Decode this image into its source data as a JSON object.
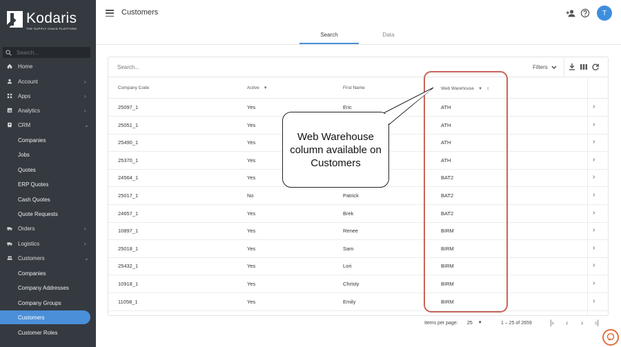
{
  "app": {
    "brand": "Kodaris",
    "tagline": "THE SUPPLY CHAIN PLATFORM"
  },
  "sidebar": {
    "search_placeholder": "Search...",
    "items": [
      {
        "label": "Home",
        "icon": "home-icon",
        "chevron": ""
      },
      {
        "label": "Account",
        "icon": "account-icon",
        "chevron": "›"
      },
      {
        "label": "Apps",
        "icon": "apps-icon",
        "chevron": "›"
      },
      {
        "label": "Analytics",
        "icon": "analytics-icon",
        "chevron": "›"
      },
      {
        "label": "CRM",
        "icon": "crm-icon",
        "chevron": "⌄"
      },
      {
        "label": "Companies",
        "icon": "",
        "chevron": ""
      },
      {
        "label": "Jobs",
        "icon": "",
        "chevron": ""
      },
      {
        "label": "Quotes",
        "icon": "",
        "chevron": ""
      },
      {
        "label": "ERP Quotes",
        "icon": "",
        "chevron": ""
      },
      {
        "label": "Cash Quotes",
        "icon": "",
        "chevron": ""
      },
      {
        "label": "Quote Requests",
        "icon": "",
        "chevron": ""
      },
      {
        "label": "Orders",
        "icon": "orders-icon",
        "chevron": "›"
      },
      {
        "label": "Logistics",
        "icon": "logistics-icon",
        "chevron": "›"
      },
      {
        "label": "Customers",
        "icon": "customers-icon",
        "chevron": "⌄"
      },
      {
        "label": "Companies",
        "icon": "",
        "chevron": ""
      },
      {
        "label": "Company Addresses",
        "icon": "",
        "chevron": ""
      },
      {
        "label": "Company Groups",
        "icon": "",
        "chevron": ""
      },
      {
        "label": "Customers",
        "icon": "",
        "chevron": ""
      },
      {
        "label": "Customer Roles",
        "icon": "",
        "chevron": ""
      }
    ]
  },
  "header": {
    "title": "Customers",
    "avatar_initial": "T"
  },
  "tabs": [
    {
      "label": "Search"
    },
    {
      "label": "Data"
    }
  ],
  "table": {
    "search_placeholder": "Search...",
    "filters_label": "Filters",
    "columns": [
      "Company Code",
      "Active",
      "First Name",
      "Web Warehouse"
    ],
    "rows": [
      [
        "25097_1",
        "Yes",
        "Eric",
        "ATH"
      ],
      [
        "25051_1",
        "Yes",
        "",
        "ATH"
      ],
      [
        "25490_1",
        "Yes",
        "",
        "ATH"
      ],
      [
        "25370_1",
        "Yes",
        "",
        "ATH"
      ],
      [
        "24564_1",
        "Yes",
        "",
        "BAT2"
      ],
      [
        "25017_1",
        "No",
        "Patrick",
        "BAT2"
      ],
      [
        "24657_1",
        "Yes",
        "Brek",
        "BAT2"
      ],
      [
        "10897_1",
        "Yes",
        "Renee",
        "BIRM"
      ],
      [
        "25018_1",
        "Yes",
        "Sam",
        "BIRM"
      ],
      [
        "25432_1",
        "Yes",
        "Lori",
        "BIRM"
      ],
      [
        "10918_1",
        "Yes",
        "Christy",
        "BIRM"
      ],
      [
        "11058_1",
        "Yes",
        "Emily",
        "BIRM"
      ]
    ]
  },
  "pagination": {
    "items_per_page_label": "Items per page:",
    "items_per_page": "25",
    "range": "1 – 25 of 2659"
  },
  "callout": {
    "text": "Web Warehouse column available on Customers"
  },
  "colors": {
    "sidebar_bg": "#353a40",
    "accent": "#4a8fd9",
    "highlight": "#c9635a"
  }
}
